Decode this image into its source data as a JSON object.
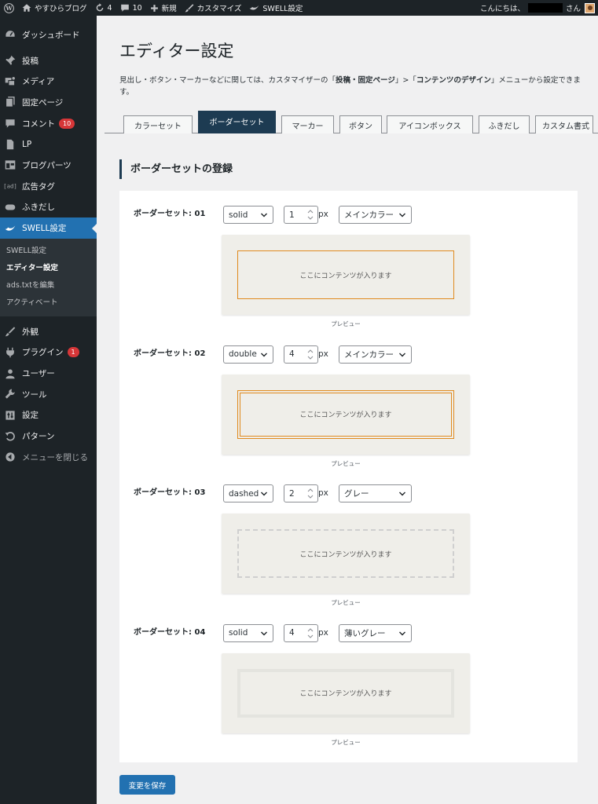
{
  "admin_bar": {
    "site_name": "やすひらブログ",
    "updates_count": "4",
    "comments_count": "10",
    "new_label": "新規",
    "customize_label": "カスタマイズ",
    "swell_label": "SWELL設定",
    "greeting": "こんにちは、",
    "greeting_suffix": "さん"
  },
  "sidebar": {
    "dashboard": "ダッシュボード",
    "posts": "投稿",
    "media": "メディア",
    "pages": "固定ページ",
    "comments": "コメント",
    "comments_badge": "10",
    "lp": "LP",
    "blog_parts": "ブログパーツ",
    "ad_tags": "広告タグ",
    "balloon": "ふきだし",
    "swell_settings": "SWELL設定",
    "submenu": [
      "SWELL設定",
      "エディター設定",
      "ads.txtを編集",
      "アクティベート"
    ],
    "appearance": "外観",
    "plugins": "プラグイン",
    "plugins_badge": "1",
    "users": "ユーザー",
    "tools": "ツール",
    "settings": "設定",
    "patterns": "パターン",
    "collapse": "メニューを閉じる"
  },
  "page": {
    "title": "エディター設定",
    "desc_1": "見出し・ボタン・マーカーなどに関しては、カスタマイザーの「",
    "desc_b1": "投稿・固定ページ",
    "desc_2": "」>「",
    "desc_b2": "コンテンツのデザイン",
    "desc_3": "」メニューから設定できます。",
    "tabs": [
      "カラーセット",
      "ボーダーセット",
      "マーカー",
      "ボタン",
      "アイコンボックス",
      "ふきだし",
      "カスタム書式"
    ],
    "active_tab": "ボーダーセット",
    "section_title": "ボーダーセットの登録",
    "preview_text": "ここにコンテンツが入ります",
    "preview_label": "プレビュー",
    "unit": "px",
    "save_label": "変更を保存"
  },
  "border_sets": [
    {
      "label": "ボーダーセット: 01",
      "style": "solid",
      "width": "1",
      "color_label": "メインカラー",
      "color": "#e08a1e"
    },
    {
      "label": "ボーダーセット: 02",
      "style": "double",
      "width": "4",
      "color_label": "メインカラー",
      "color": "#e08a1e"
    },
    {
      "label": "ボーダーセット: 03",
      "style": "dashed",
      "width": "2",
      "color_label": "グレー",
      "color": "#cfcfcf"
    },
    {
      "label": "ボーダーセット: 04",
      "style": "solid",
      "width": "4",
      "color_label": "薄いグレー",
      "color": "#e4e4df"
    }
  ],
  "colors": {
    "admin_dark": "#1d2327",
    "accent_blue": "#2271b1",
    "active_tab": "#1d3b52",
    "badge_red": "#d63638"
  }
}
